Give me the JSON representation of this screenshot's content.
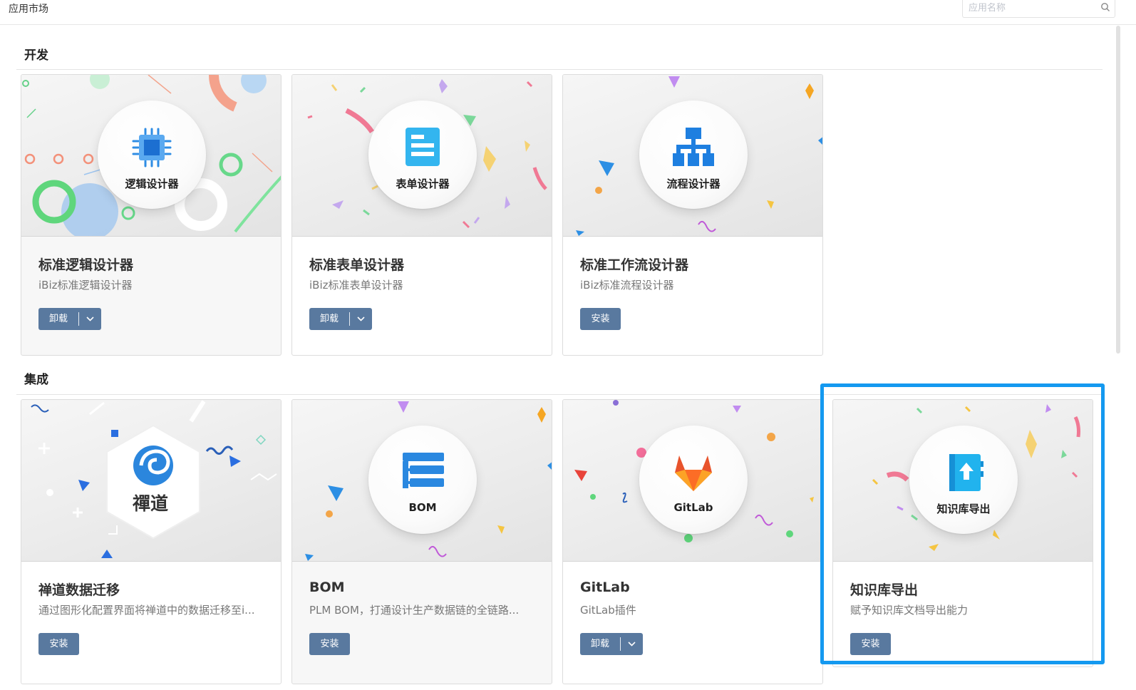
{
  "header": {
    "title": "应用市场",
    "search": {
      "placeholder": "应用名称",
      "value": ""
    }
  },
  "sections": [
    {
      "title": "开发",
      "apps": [
        {
          "badge": "逻辑设计器",
          "icon": "chip-icon",
          "name": "标准逻辑设计器",
          "desc": "iBiz标准逻辑设计器",
          "action": "卸载",
          "has_dropdown": true
        },
        {
          "badge": "表单设计器",
          "icon": "form-icon",
          "name": "标准表单设计器",
          "desc": "iBiz标准表单设计器",
          "action": "卸载",
          "has_dropdown": true
        },
        {
          "badge": "流程设计器",
          "icon": "flowchart-icon",
          "name": "标准工作流设计器",
          "desc": "iBiz标准流程设计器",
          "action": "安装",
          "has_dropdown": false
        }
      ]
    },
    {
      "title": "集成",
      "apps": [
        {
          "badge": "禪道",
          "icon": "zentao-logo",
          "name": "禅道数据迁移",
          "desc": "通过图形化配置界面将禅道中的数据迁移至i...",
          "action": "安装",
          "has_dropdown": false
        },
        {
          "badge": "BOM",
          "icon": "bom-tree-icon",
          "name": "BOM",
          "desc": "PLM BOM，打通设计生产数据链的全链路...",
          "action": "安装",
          "has_dropdown": false
        },
        {
          "badge": "GitLab",
          "icon": "gitlab-logo",
          "name": "GitLab",
          "desc": "GitLab插件",
          "action": "卸载",
          "has_dropdown": true
        },
        {
          "badge": "知识库导出",
          "icon": "export-book-icon",
          "name": "知识库导出",
          "desc": "赋予知识库文档导出能力",
          "action": "安装",
          "has_dropdown": false
        }
      ]
    }
  ],
  "colors": {
    "button": "#59799f",
    "highlight": "#1499f0",
    "accent_blue": "#1e88e5"
  }
}
